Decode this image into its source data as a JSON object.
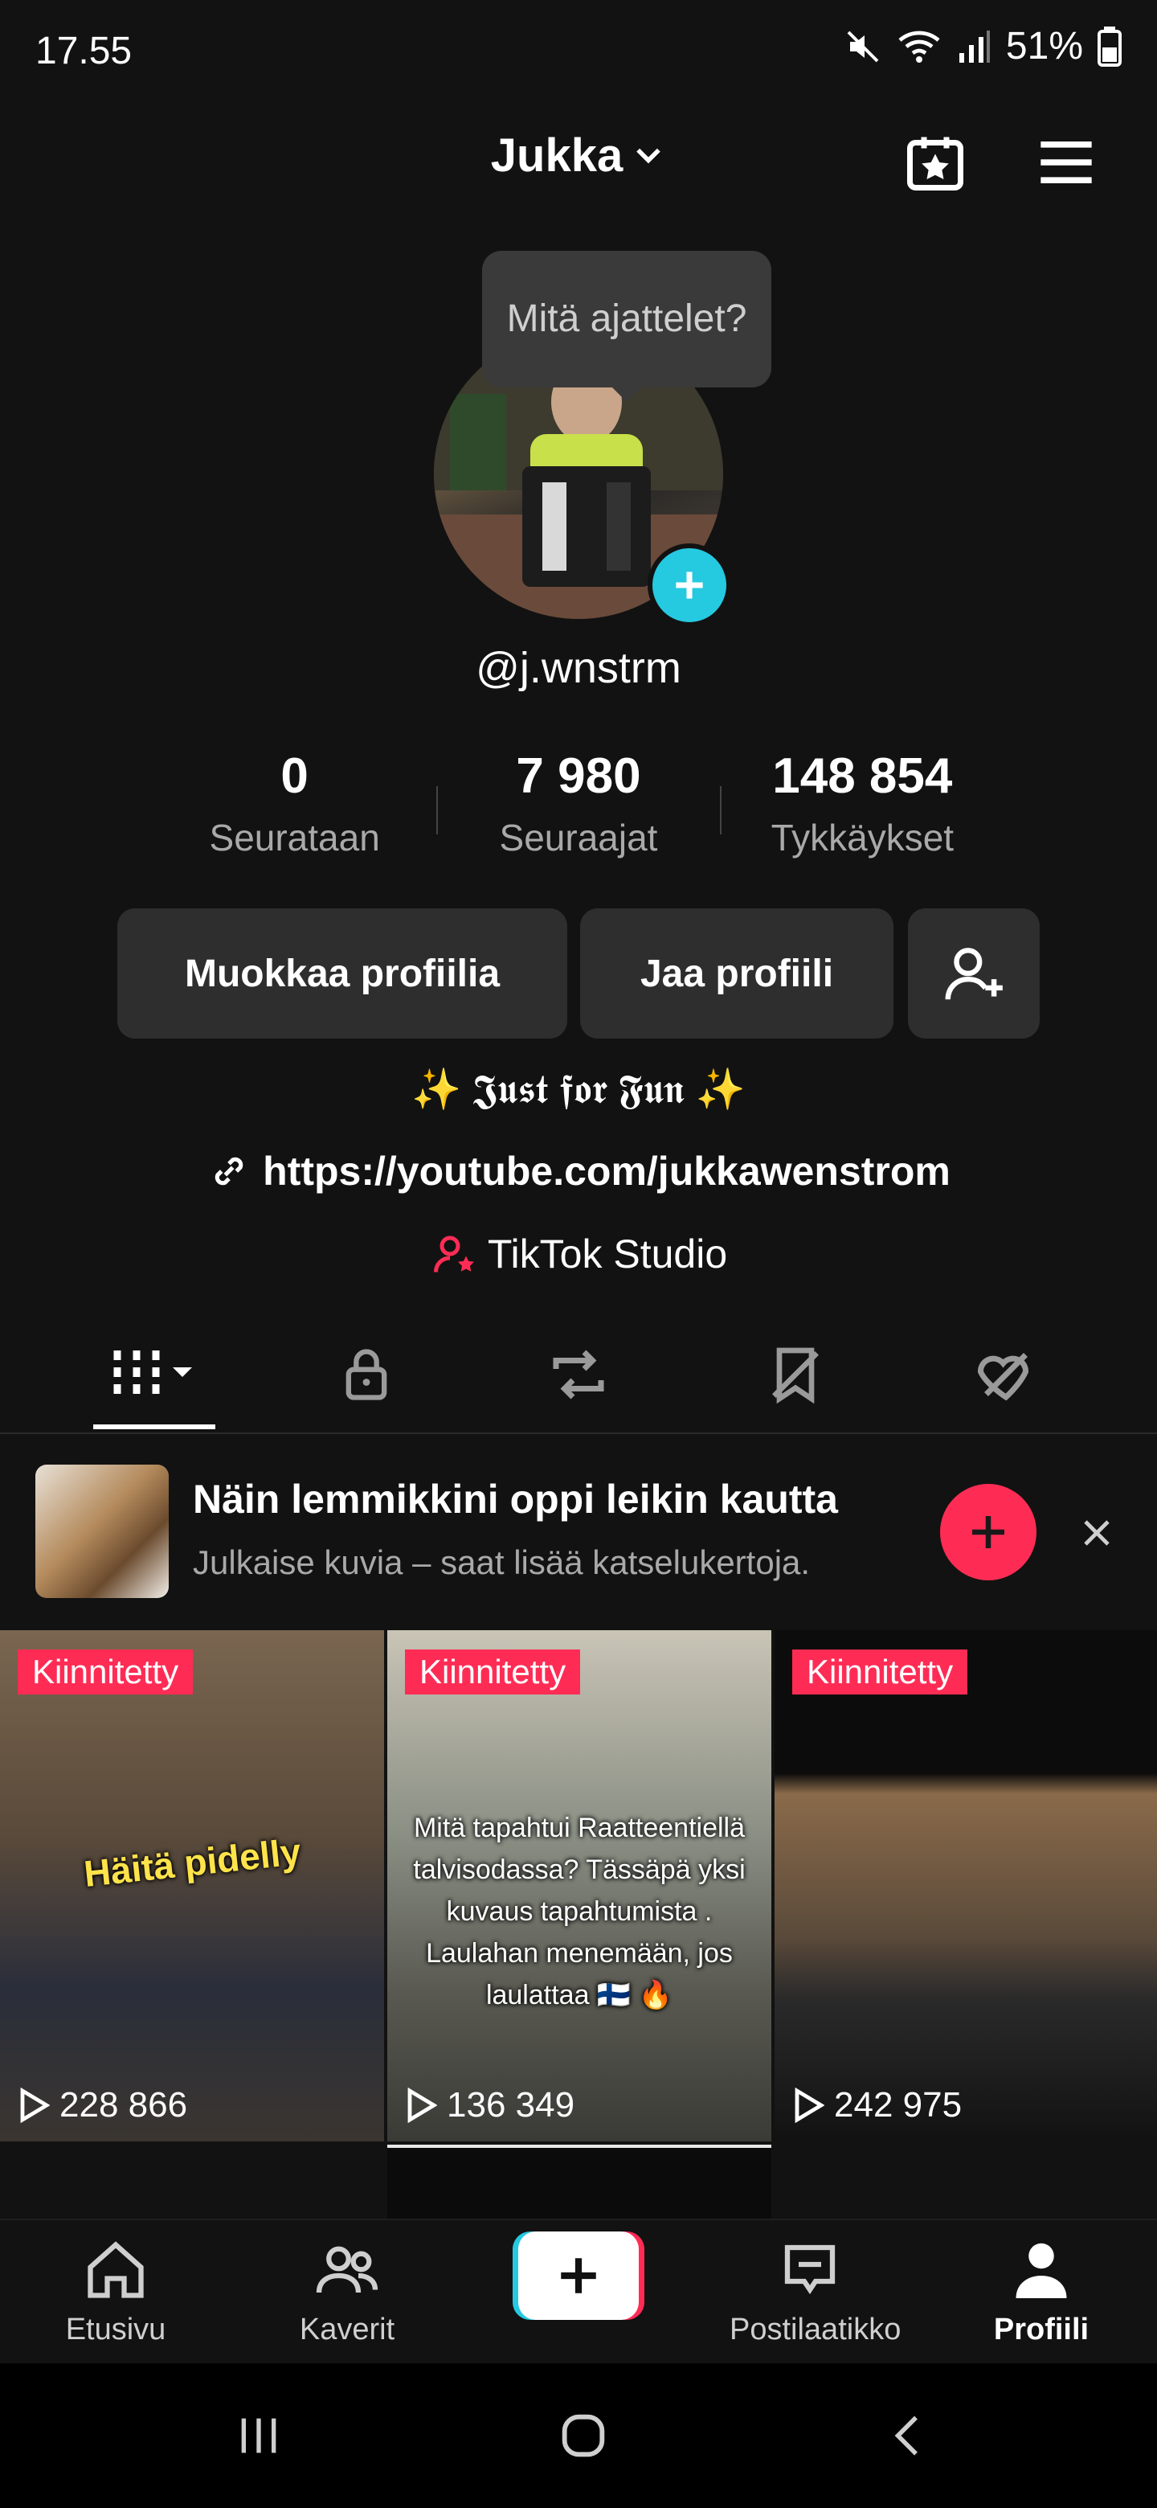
{
  "status_bar": {
    "time": "17.55",
    "battery": "51%",
    "icons": [
      "mute-icon",
      "wifi-icon",
      "signal-icon",
      "battery-icon"
    ]
  },
  "header": {
    "username": "Jukka",
    "icons": [
      "calendar-star-icon",
      "menu-icon"
    ]
  },
  "tooltip": {
    "text": "Mitä ajattelet?"
  },
  "profile": {
    "handle": "@j.wnstrm",
    "stats": [
      {
        "value": "0",
        "label": "Seurataan"
      },
      {
        "value": "7 980",
        "label": "Seuraajat"
      },
      {
        "value": "148 854",
        "label": "Tykkäykset"
      }
    ],
    "buttons": {
      "edit": "Muokkaa profiilia",
      "share": "Jaa profiili"
    },
    "bio": "✨ 𝕵𝖚𝖘𝖙 𝖋𝖔𝖗 𝕱𝖚𝖓 ✨",
    "link": "https://youtube.com/jukkawenstrom",
    "studio": "TikTok Studio"
  },
  "tabs": [
    "videos",
    "private",
    "reposts",
    "favorites",
    "liked"
  ],
  "promo": {
    "title": "Näin lemmikkini oppi leikin kautta",
    "subtitle": "Julkaise kuvia – saat lisää katselukertoja."
  },
  "videos": [
    {
      "pinned": "Kiinnitetty",
      "views": "228 866",
      "caption": "Häitä pidelly"
    },
    {
      "pinned": "Kiinnitetty",
      "views": "136 349",
      "caption": "Mitä tapahtui Raatteentiellä talvisodassa? Tässäpä yksi kuvaus tapahtumista . Laulahan menemään, jos laulattaa 🇫🇮 🔥"
    },
    {
      "pinned": "Kiinnitetty",
      "views": "242 975",
      "caption": ""
    }
  ],
  "bottom_nav": [
    {
      "label": "Etusivu",
      "icon": "home-icon"
    },
    {
      "label": "Kaverit",
      "icon": "friends-icon"
    },
    {
      "label": "",
      "icon": "create-icon"
    },
    {
      "label": "Postilaatikko",
      "icon": "inbox-icon"
    },
    {
      "label": "Profiili",
      "icon": "profile-icon"
    }
  ],
  "colors": {
    "accent": "#fe2c55",
    "cyan": "#25c9e0",
    "background": "#121212"
  }
}
